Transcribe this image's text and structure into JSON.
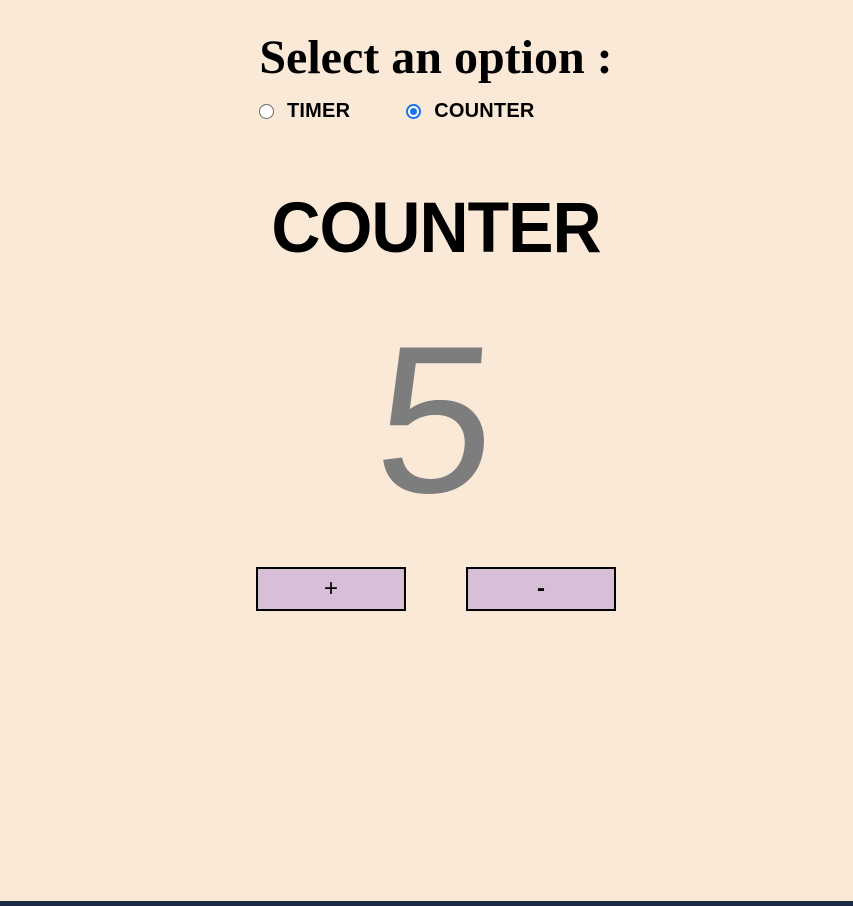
{
  "header": {
    "title": "Select an option :"
  },
  "options": [
    {
      "label": "TIMER",
      "checked": false
    },
    {
      "label": "COUNTER",
      "checked": true
    }
  ],
  "main": {
    "mode_title": "COUNTER",
    "count": "5"
  },
  "controls": {
    "increment_label": "+",
    "decrement_label": "-",
    "button_color": "#d8bfd8"
  },
  "colors": {
    "background": "#fae9d7",
    "radio_accent": "#1a73e8",
    "count_color": "#7d7d7d"
  }
}
